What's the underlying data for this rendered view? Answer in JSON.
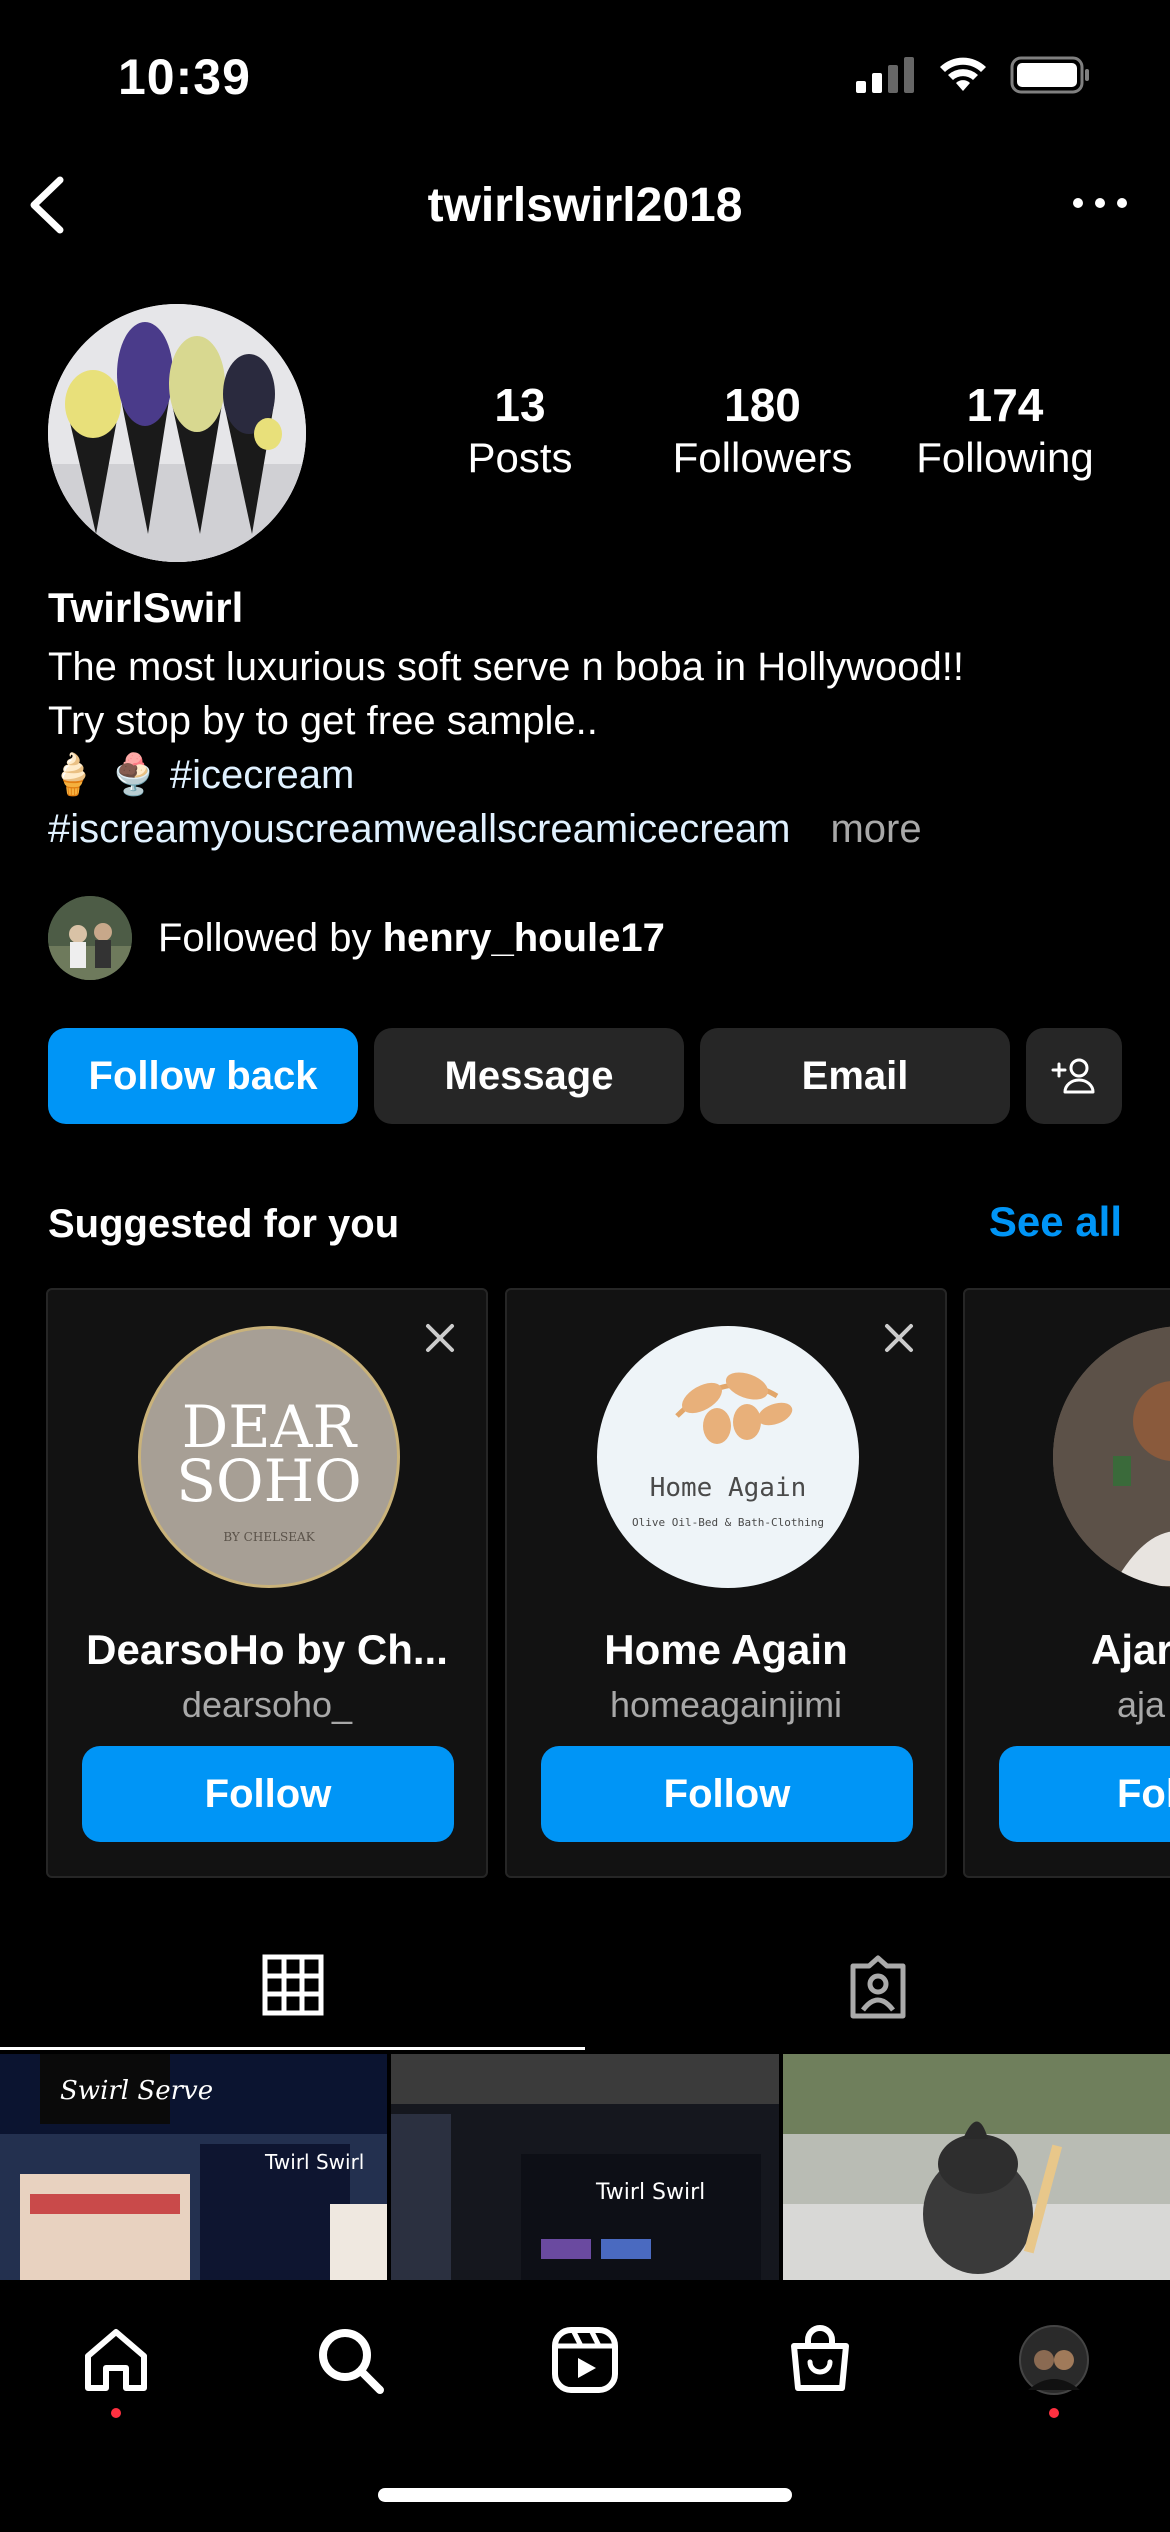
{
  "status_bar": {
    "time": "10:39"
  },
  "header": {
    "username": "twirlswirl2018"
  },
  "profile": {
    "stats": [
      {
        "value": "13",
        "label": "Posts"
      },
      {
        "value": "180",
        "label": "Followers"
      },
      {
        "value": "174",
        "label": "Following"
      }
    ],
    "display_name": "TwirlSwirl",
    "bio_line1": "The most luxurious soft serve n boba in Hollywood!!",
    "bio_line2": "Try stop by to get free sample..",
    "bio_emojis": "🍦 🍨",
    "bio_hashtag1": "#icecream",
    "bio_hashtag2": "#iscreamyouscreamweallscreamicecream",
    "bio_more": "more",
    "followed_by_prefix": "Followed by",
    "followed_by_user": "henry_houle17"
  },
  "actions": {
    "follow_back": "Follow back",
    "message": "Message",
    "email": "Email"
  },
  "suggested": {
    "title": "Suggested for you",
    "see_all": "See all",
    "cards": [
      {
        "name": "DearsoHo by Ch...",
        "username": "dearsoho_",
        "button": "Follow",
        "logo_line1": "DEAR",
        "logo_line2": "SOHO",
        "logo_small": "BY CHELSEAK"
      },
      {
        "name": "Home Again",
        "username": "homeagainjimi",
        "button": "Follow",
        "logo_title": "Home Again",
        "logo_sub": "Olive Oil-Bed & Bath-Clothing"
      },
      {
        "name": "Ajar",
        "username": "aja",
        "button": "Fol"
      }
    ]
  },
  "posts": [
    {
      "sign": "Twirl Swirl"
    },
    {
      "sign": "Twirl Swirl"
    },
    {
      "sign": ""
    }
  ],
  "colors": {
    "accent": "#0095f6",
    "button_dark": "#262626",
    "notification": "#ff3040"
  }
}
